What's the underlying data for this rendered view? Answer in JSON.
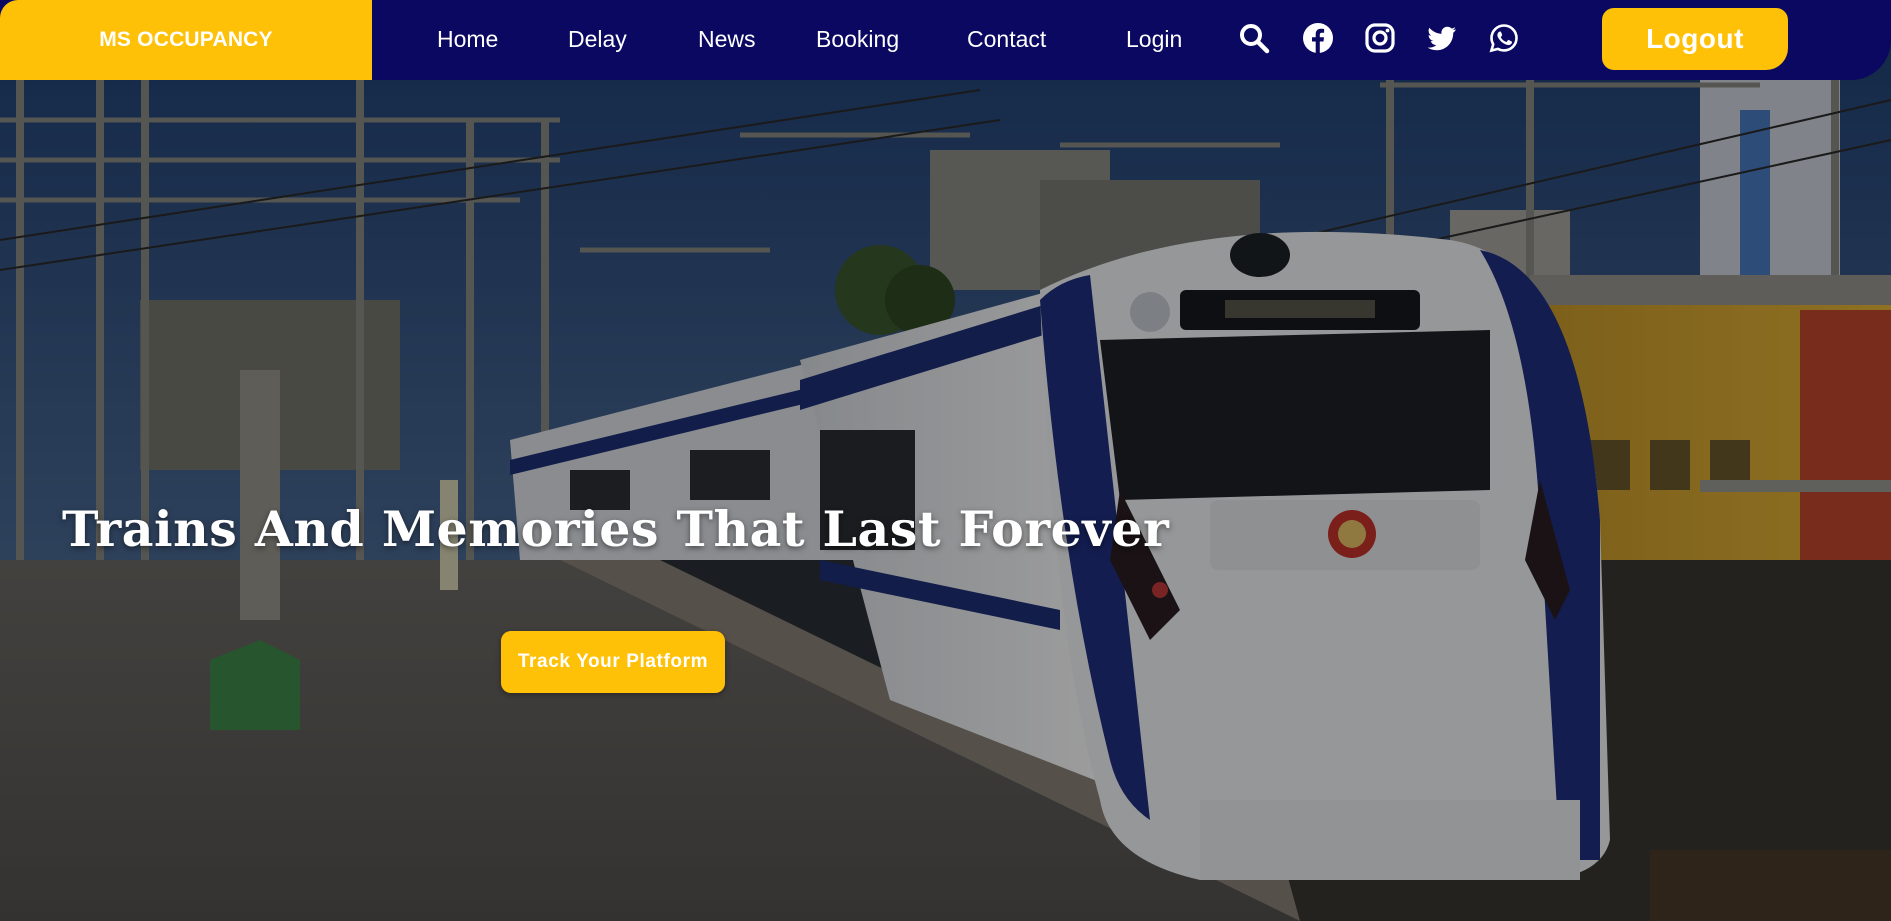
{
  "navbar": {
    "brand": "MS OCCUPANCY",
    "links": [
      "Home",
      "Delay",
      "News",
      "Booking",
      "Contact",
      "Login"
    ],
    "icons": [
      "search-icon",
      "facebook-icon",
      "instagram-icon",
      "twitter-icon",
      "whatsapp-icon"
    ],
    "logout_label": "Logout"
  },
  "hero": {
    "headline": "Trains And Memories That Last Forever",
    "cta_label": "Track Your Platform"
  },
  "colors": {
    "navbar": "#0a0861",
    "accent": "#ffc107",
    "text": "#ffffff"
  }
}
